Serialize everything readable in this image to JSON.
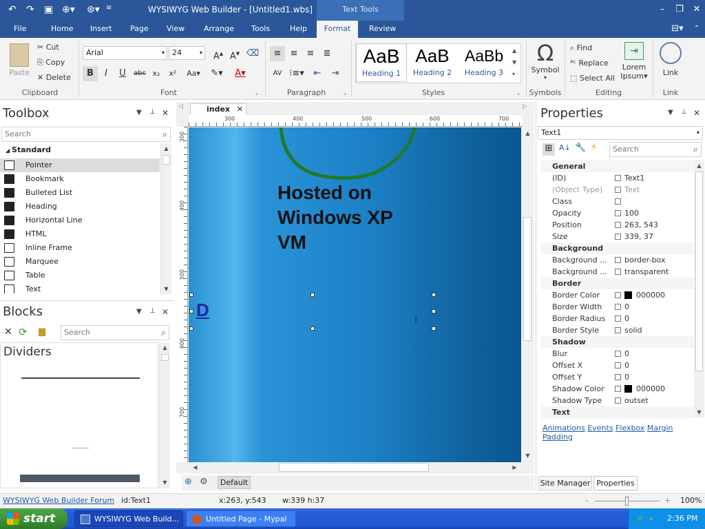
{
  "titlebar": {
    "title": "WYSIWYG Web Builder - [Untitled1.wbs]",
    "context_tab": "Text Tools"
  },
  "menu": {
    "tabs": [
      "File",
      "Home",
      "Insert",
      "Page",
      "View",
      "Arrange",
      "Tools",
      "Help",
      "Format",
      "Review"
    ],
    "active": "Format"
  },
  "ribbon": {
    "clipboard": {
      "paste": "Paste",
      "cut": "Cut",
      "copy": "Copy",
      "delete": "Delete",
      "label": "Clipboard"
    },
    "font": {
      "family": "Arial",
      "size": "24",
      "label": "Font",
      "bold": "B",
      "italic": "I",
      "underline": "U",
      "strike": "abc",
      "sub": "x₂",
      "sup": "x²",
      "case": "Aa"
    },
    "paragraph": {
      "label": "Paragraph"
    },
    "styles": {
      "items": [
        {
          "big": "AaB",
          "name": "Heading 1"
        },
        {
          "big": "AaB",
          "name": "Heading 2"
        },
        {
          "big": "AaBb",
          "name": "Heading 3"
        }
      ],
      "label": "Styles"
    },
    "symbols": {
      "symbol": "Symbol",
      "glyph": "Ω",
      "label": "Symbols"
    },
    "editing": {
      "find": "Find",
      "replace": "Replace",
      "select_all": "Select All",
      "lorem": "Lorem",
      "ipsum": "Ipsum",
      "label": "Editing"
    },
    "link": {
      "link": "Link",
      "label": "Link"
    }
  },
  "toolbox": {
    "title": "Toolbox",
    "search": "Search",
    "category": "Standard",
    "items": [
      "Pointer",
      "Bookmark",
      "Bulleted List",
      "Heading",
      "Horizontal Line",
      "HTML",
      "Inline Frame",
      "Marquee",
      "Table",
      "Text"
    ]
  },
  "blocks": {
    "title": "Blocks",
    "search": "Search",
    "category": "Dividers"
  },
  "document": {
    "tab": "index",
    "ruler_h": [
      "300",
      "400",
      "500",
      "600",
      "700"
    ],
    "ruler_v": [
      "300",
      "400",
      "500",
      "600",
      "700"
    ],
    "heading_text": "Hosted on Windows XP VM",
    "text1_char": "D",
    "footer_tab": "Default"
  },
  "properties": {
    "title": "Properties",
    "object": "Text1",
    "search": "Search",
    "rows": [
      {
        "cat": true,
        "name": "General"
      },
      {
        "name": "(ID)",
        "value": "Text1"
      },
      {
        "name": "(Object Type)",
        "value": "Text",
        "muted": true
      },
      {
        "name": "Class",
        "value": ""
      },
      {
        "name": "Opacity",
        "value": "100"
      },
      {
        "name": "Position",
        "value": "263, 543"
      },
      {
        "name": "Size",
        "value": "339, 37"
      },
      {
        "cat": true,
        "name": "Background"
      },
      {
        "name": "Background ...",
        "value": "border-box"
      },
      {
        "name": "Background ...",
        "value": "transparent"
      },
      {
        "cat": true,
        "name": "Border"
      },
      {
        "name": "Border Color",
        "value": "000000",
        "swatch": true
      },
      {
        "name": "Border Width",
        "value": "0"
      },
      {
        "name": "Border Radius",
        "value": "0"
      },
      {
        "name": "Border Style",
        "value": "solid"
      },
      {
        "cat": true,
        "name": "Shadow"
      },
      {
        "name": "Blur",
        "value": "0"
      },
      {
        "name": "Offset X",
        "value": "0"
      },
      {
        "name": "Offset Y",
        "value": "0"
      },
      {
        "name": "Shadow Color",
        "value": "000000",
        "swatch": true
      },
      {
        "name": "Shadow Type",
        "value": "outset"
      },
      {
        "cat": true,
        "name": "Text"
      }
    ],
    "links": [
      "Animations",
      "Events",
      "Flexbox",
      "Margin",
      "Padding"
    ],
    "bottom_tabs": [
      "Site Manager",
      "Properties"
    ]
  },
  "status": {
    "forum": "WYSIWYG Web Builder Forum",
    "id": "id:Text1",
    "pos": "x:263, y:543",
    "size": "w:339 h:37",
    "zoom": "100%"
  },
  "taskbar": {
    "start": "start",
    "tasks": [
      "WYSIWYG Web Build...",
      "Untitled Page - Mypal"
    ],
    "time": "2:36 PM"
  },
  "colors": {
    "accent": "#2b579a",
    "canvas": "#1c80c5",
    "taskbar": "#245edb",
    "start": "#3a8f34"
  }
}
